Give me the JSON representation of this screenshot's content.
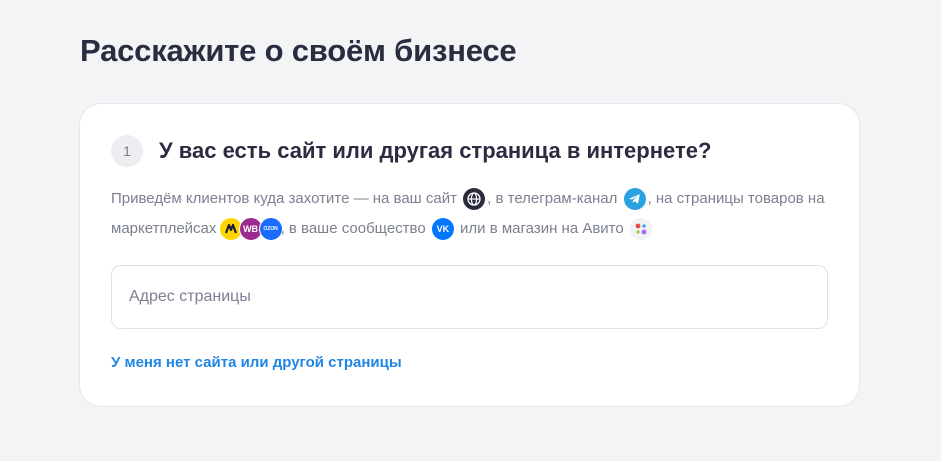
{
  "header": {
    "title": "Расскажите о своём бизнесе"
  },
  "step": {
    "number": "1",
    "question": "У вас есть сайт или другая страница в интернете?"
  },
  "description": {
    "part1": "Приведём клиентов куда захотите — на ваш сайт",
    "part2": ", в телеграм-канал",
    "part3": ", на страницы товаров на маркетплейсах",
    "part4": ", в ваше сообщество",
    "part5": "или в магазин на Авито",
    "icons": [
      "globe-icon",
      "telegram-icon",
      "yandex-market-icon",
      "wildberries-icon",
      "ozon-icon",
      "vk-icon",
      "avito-icon"
    ],
    "wb_text": "WB",
    "ozon_text": "OZON",
    "vk_text": "VK"
  },
  "input": {
    "placeholder": "Адрес страницы",
    "value": ""
  },
  "link": {
    "no_site": "У меня нет сайта или другой страницы"
  },
  "colors": {
    "accent": "#1f86e6",
    "title": "#2b2c3f",
    "muted": "#7c8091",
    "background": "#f3f4f6",
    "card": "#ffffff"
  }
}
